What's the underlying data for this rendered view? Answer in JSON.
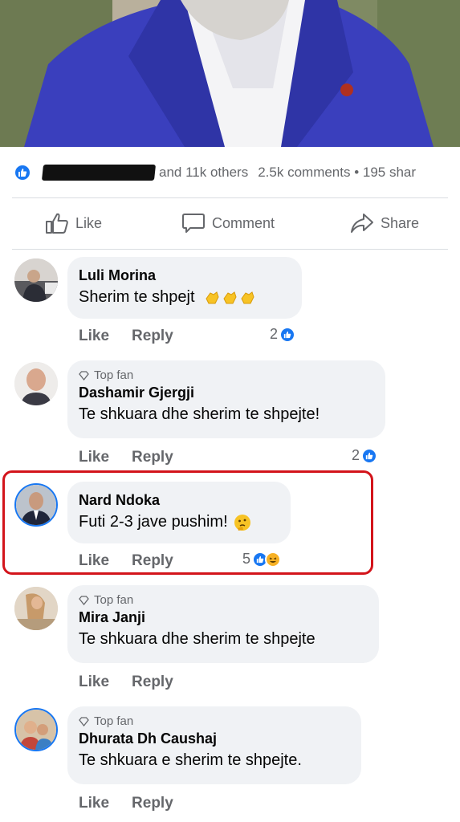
{
  "summary": {
    "others": "and 11k others",
    "comments": "2.5k comments • 195 shar"
  },
  "actions": {
    "like": "Like",
    "comment": "Comment",
    "share": "Share"
  },
  "comments": [
    {
      "author": "Luli Morina",
      "text": "Sherim te shpejt",
      "emoji": "clapping-hands-icon x3",
      "like_label": "Like",
      "reply_label": "Reply",
      "reaction_count": "2",
      "top_fan": ""
    },
    {
      "author": "Dashamir Gjergji",
      "text": "Te shkuara dhe sherim te shpejte!",
      "like_label": "Like",
      "reply_label": "Reply",
      "reaction_count": "2",
      "top_fan": "Top fan"
    },
    {
      "author": "Nard Ndoka",
      "text": "Futi 2-3 jave pushim!",
      "emoji": "thinking-face-icon",
      "like_label": "Like",
      "reply_label": "Reply",
      "reaction_count": "5",
      "top_fan": ""
    },
    {
      "author": "Mira Janji",
      "text": "Te shkuara dhe sherim te shpejte",
      "like_label": "Like",
      "reply_label": "Reply",
      "top_fan": "Top fan"
    },
    {
      "author": "Dhurata Dh Caushaj",
      "text": "Te shkuara e sherim te shpejte.",
      "like_label": "Like",
      "reply_label": "Reply",
      "top_fan": "Top fan"
    }
  ],
  "colors": {
    "like_blue": "#1877f2",
    "highlight_red": "#d3141b",
    "bubble_gray": "#f0f2f5",
    "meta_gray": "#65676b"
  }
}
